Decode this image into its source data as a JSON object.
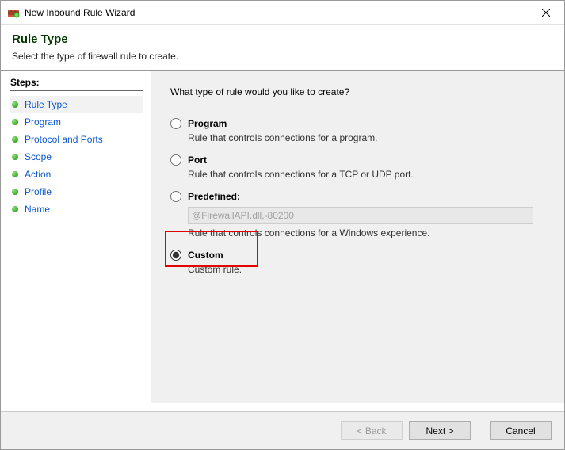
{
  "window": {
    "title": "New Inbound Rule Wizard"
  },
  "header": {
    "title": "Rule Type",
    "subtitle": "Select the type of firewall rule to create."
  },
  "steps": {
    "heading": "Steps:",
    "items": [
      {
        "label": "Rule Type",
        "current": true
      },
      {
        "label": "Program",
        "current": false
      },
      {
        "label": "Protocol and Ports",
        "current": false
      },
      {
        "label": "Scope",
        "current": false
      },
      {
        "label": "Action",
        "current": false
      },
      {
        "label": "Profile",
        "current": false
      },
      {
        "label": "Name",
        "current": false
      }
    ]
  },
  "content": {
    "question": "What type of rule would you like to create?",
    "options": {
      "program": {
        "label": "Program",
        "desc": "Rule that controls connections for a program."
      },
      "port": {
        "label": "Port",
        "desc": "Rule that controls connections for a TCP or UDP port."
      },
      "predefined": {
        "label": "Predefined:",
        "select_value": "@FirewallAPI.dll,-80200",
        "desc": "Rule that controls connections for a Windows experience."
      },
      "custom": {
        "label": "Custom",
        "desc": "Custom rule."
      }
    },
    "selected": "custom"
  },
  "buttons": {
    "back": "< Back",
    "next": "Next >",
    "cancel": "Cancel"
  }
}
